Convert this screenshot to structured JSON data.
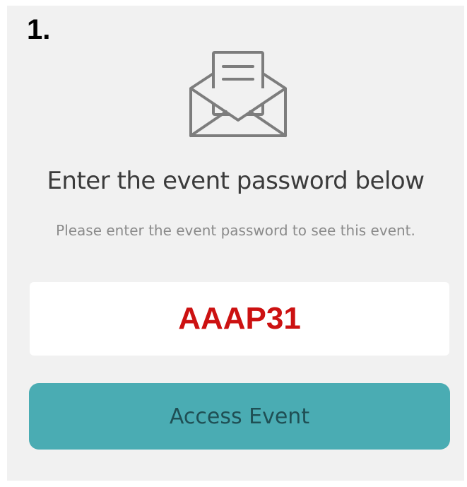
{
  "step": {
    "number": "1."
  },
  "icons": {
    "envelope": "envelope-letter-icon"
  },
  "dialog": {
    "title": "Enter the event password below",
    "subtitle": "Please enter the event password to see this event.",
    "password_value": "AAAP31",
    "submit_label": "Access Event"
  },
  "colors": {
    "background": "#f1f1f1",
    "accent": "#4aacb3",
    "password_text": "#cc1111"
  }
}
